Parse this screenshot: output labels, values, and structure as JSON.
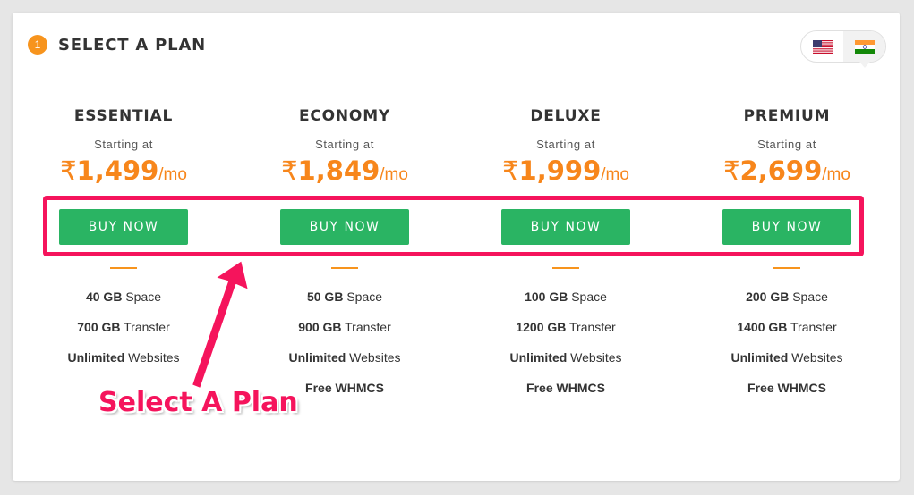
{
  "header": {
    "step_number": "1",
    "title": "SELECT A PLAN"
  },
  "currency_switch": {
    "options": [
      {
        "name": "us-flag-icon",
        "active": false
      },
      {
        "name": "india-flag-icon",
        "active": true
      }
    ]
  },
  "plans": [
    {
      "name": "ESSENTIAL",
      "starting_label": "Starting at",
      "currency_symbol": "₹",
      "price": "1,499",
      "unit": "/mo",
      "button_label": "BUY NOW",
      "features": [
        {
          "value": "40 GB",
          "text": " Space"
        },
        {
          "value": "700 GB",
          "text": " Transfer"
        },
        {
          "value": "Unlimited",
          "text": " Websites"
        }
      ]
    },
    {
      "name": "ECONOMY",
      "starting_label": "Starting at",
      "currency_symbol": "₹",
      "price": "1,849",
      "unit": "/mo",
      "button_label": "BUY NOW",
      "features": [
        {
          "value": "50 GB",
          "text": " Space"
        },
        {
          "value": "900 GB",
          "text": " Transfer"
        },
        {
          "value": "Unlimited",
          "text": " Websites"
        },
        {
          "value": "Free WHMCS",
          "text": ""
        }
      ]
    },
    {
      "name": "DELUXE",
      "starting_label": "Starting at",
      "currency_symbol": "₹",
      "price": "1,999",
      "unit": "/mo",
      "button_label": "BUY NOW",
      "features": [
        {
          "value": "100 GB",
          "text": " Space"
        },
        {
          "value": "1200 GB",
          "text": " Transfer"
        },
        {
          "value": "Unlimited",
          "text": " Websites"
        },
        {
          "value": "Free WHMCS",
          "text": ""
        }
      ]
    },
    {
      "name": "PREMIUM",
      "starting_label": "Starting at",
      "currency_symbol": "₹",
      "price": "2,699",
      "unit": "/mo",
      "button_label": "BUY NOW",
      "features": [
        {
          "value": "200 GB",
          "text": " Space"
        },
        {
          "value": "1400 GB",
          "text": " Transfer"
        },
        {
          "value": "Unlimited",
          "text": " Websites"
        },
        {
          "value": "Free WHMCS",
          "text": ""
        }
      ]
    }
  ],
  "annotation": {
    "label": "Select A Plan",
    "color": "#f5145c"
  },
  "colors": {
    "accent": "#f7861b",
    "buy_button": "#2ab463"
  }
}
